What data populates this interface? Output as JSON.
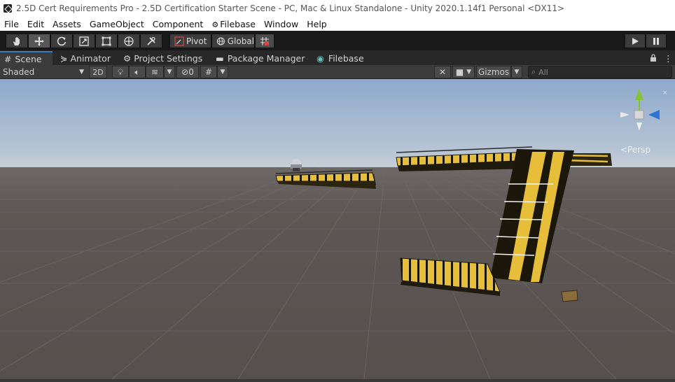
{
  "window": {
    "title": "2.5D Cert Requirements Pro - 2.5D Certification Starter Scene - PC, Mac & Linux Standalone - Unity 2020.1.14f1 Personal <DX11>"
  },
  "menu": [
    "File",
    "Edit",
    "Assets",
    "GameObject",
    "Component",
    "Filebase",
    "Window",
    "Help"
  ],
  "toolbar": {
    "tools": [
      "hand-tool",
      "move-tool",
      "rotate-tool",
      "scale-tool",
      "rect-tool",
      "transform-tool",
      "custom-tool"
    ],
    "pivot_label": "Pivot",
    "global_label": "Global",
    "play": "play",
    "pause": "pause"
  },
  "tabs": {
    "scene": "Scene",
    "animator": "Animator",
    "project_settings": "Project Settings",
    "package_manager": "Package Manager",
    "filebase": "Filebase"
  },
  "scene_toolbar": {
    "shading_mode": "Shaded",
    "mode_2d": "2D",
    "hidden_count": "0",
    "gizmos_label": "Gizmos",
    "search_placeholder": "All"
  },
  "viewport": {
    "projection_label": "<Persp",
    "colors": {
      "sky_top": "#8ea9cd",
      "horizon": "#c5cfd8",
      "ground": "#5a5552",
      "platform": "#e6be3a",
      "axis_x": "#d42f2f",
      "axis_y": "#86c235",
      "axis_z": "#2f74d4"
    }
  }
}
